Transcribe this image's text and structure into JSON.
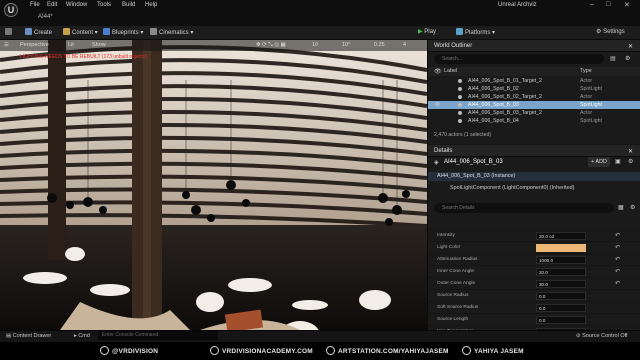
{
  "topbar": {
    "menus": [
      "File",
      "Edit",
      "Window",
      "Tools",
      "Build",
      "Help"
    ],
    "project_tab": "AI44*",
    "app_title": "Unreal Archviz",
    "window_buttons": [
      "–",
      "□",
      "✕"
    ]
  },
  "toolbar": {
    "save_icon": "save-icon",
    "create": "Create",
    "content": "Content",
    "blueprints": "Blueprints",
    "cinematics": "Cinematics",
    "play": "Play",
    "platforms": "Platforms",
    "settings": "Settings"
  },
  "viewport": {
    "perspective": "Perspective",
    "lit": "Lit",
    "show": "Show",
    "grid_snap": "10",
    "rot_snap": "10°",
    "scale_snap": "0.25",
    "camera_speed": "4",
    "warning": "LIGHTING NEEDS TO BE REBUILT (173 unbuilt objects)"
  },
  "outliner": {
    "title": "World Outliner",
    "search_placeholder": "Search...",
    "col_label": "Label",
    "col_type": "Type",
    "rows": [
      {
        "name": "AI44_006_Spot_B_01_Target_2",
        "type": "Actor",
        "selected": false
      },
      {
        "name": "AI44_006_Spot_B_02",
        "type": "SpotLight",
        "selected": false
      },
      {
        "name": "AI44_006_Spot_B_02_Target_2",
        "type": "Actor",
        "selected": false
      },
      {
        "name": "AI44_006_Spot_B_03",
        "type": "SpotLight",
        "selected": true
      },
      {
        "name": "AI44_006_Spot_B_03_Target_2",
        "type": "Actor",
        "selected": false
      },
      {
        "name": "AI44_006_Spot_B_04",
        "type": "SpotLight",
        "selected": false
      }
    ],
    "actor_count": "2,470 actors (1 selected)"
  },
  "details": {
    "title": "Details",
    "name": "AI44_006_Spot_B_03",
    "add_label": "+ ADD",
    "instance": "AI44_006_Spot_B_03 (Instance)",
    "component": "SpotLightComponent (LightComponent0) (Inherited)",
    "search_placeholder": "Search Details",
    "properties": [
      {
        "label": "Intensity",
        "value": "20.0 cd"
      },
      {
        "label": "Light Color",
        "value": ""
      },
      {
        "label": "Attenuation Radius",
        "value": "1000.0"
      },
      {
        "label": "Inner Cone Angle",
        "value": "20.0"
      },
      {
        "label": "Outer Cone Angle",
        "value": "30.0"
      },
      {
        "label": "Source Radius",
        "value": "0.0"
      },
      {
        "label": "Soft Source Radius",
        "value": "0.0"
      },
      {
        "label": "Source Length",
        "value": "0.0"
      },
      {
        "label": "Use Temperature",
        "value": ""
      }
    ],
    "light_color_hex": "#f0b877"
  },
  "bottombar": {
    "content_drawer": "Content Drawer",
    "cmd": "Cmd",
    "cmd_placeholder": "Enter Console Command",
    "source_control": "Source Control Off"
  },
  "credits": {
    "handle": "@VRDIVISION",
    "site1": "VRDIVISIONACADEMY.COM",
    "site2": "ARTSTATION.COM/YAHIYAJASEM",
    "name": "YAHIYA JASEM"
  },
  "colors": {
    "accent_selection": "#7aa4c9",
    "play_green": "#3ec24a"
  }
}
